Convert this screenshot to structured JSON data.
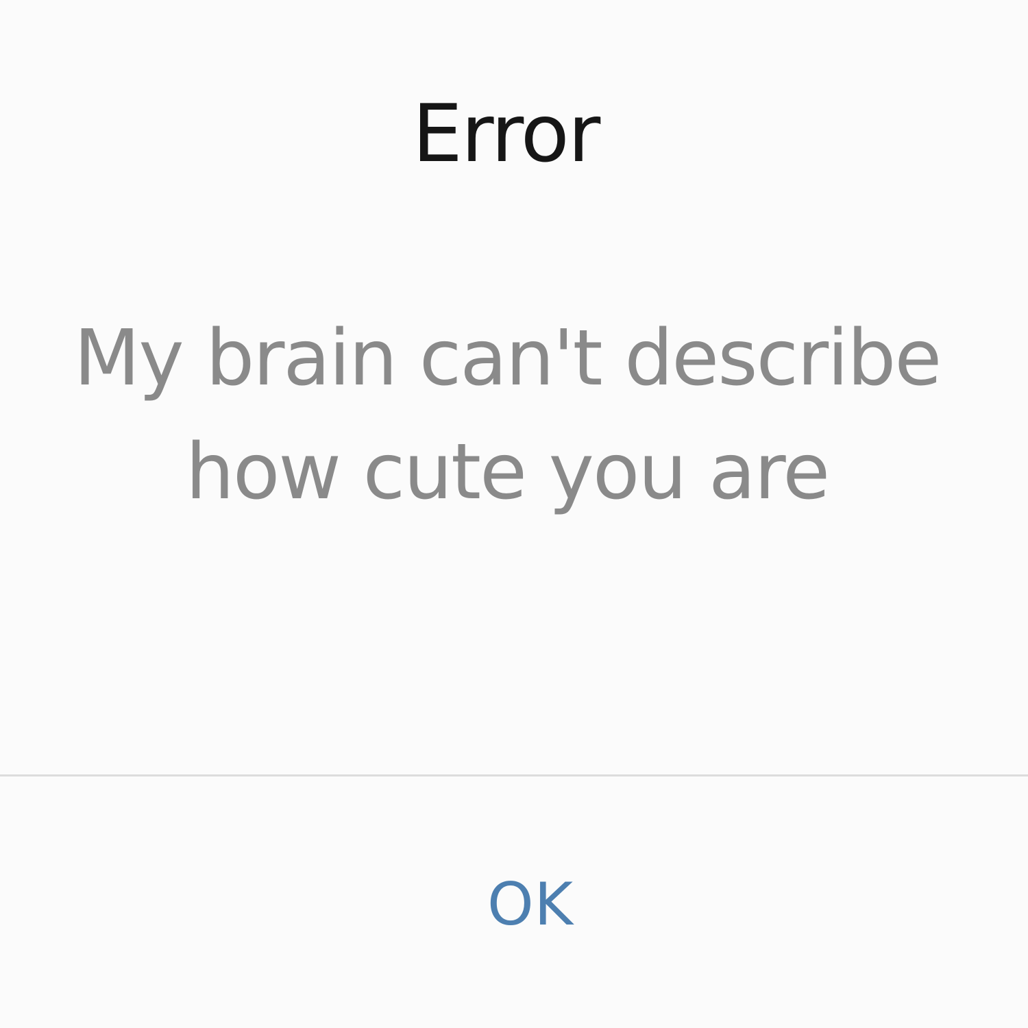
{
  "dialog": {
    "title": "Error",
    "message_lines": [
      "My brain can't describe",
      "how cute you are"
    ],
    "ok_label": "OK"
  },
  "colors": {
    "background": "#fbfbfb",
    "title": "#161616",
    "message": "#8a8a8a",
    "accent": "#4d7fb0",
    "divider": "#dcdcdc"
  }
}
